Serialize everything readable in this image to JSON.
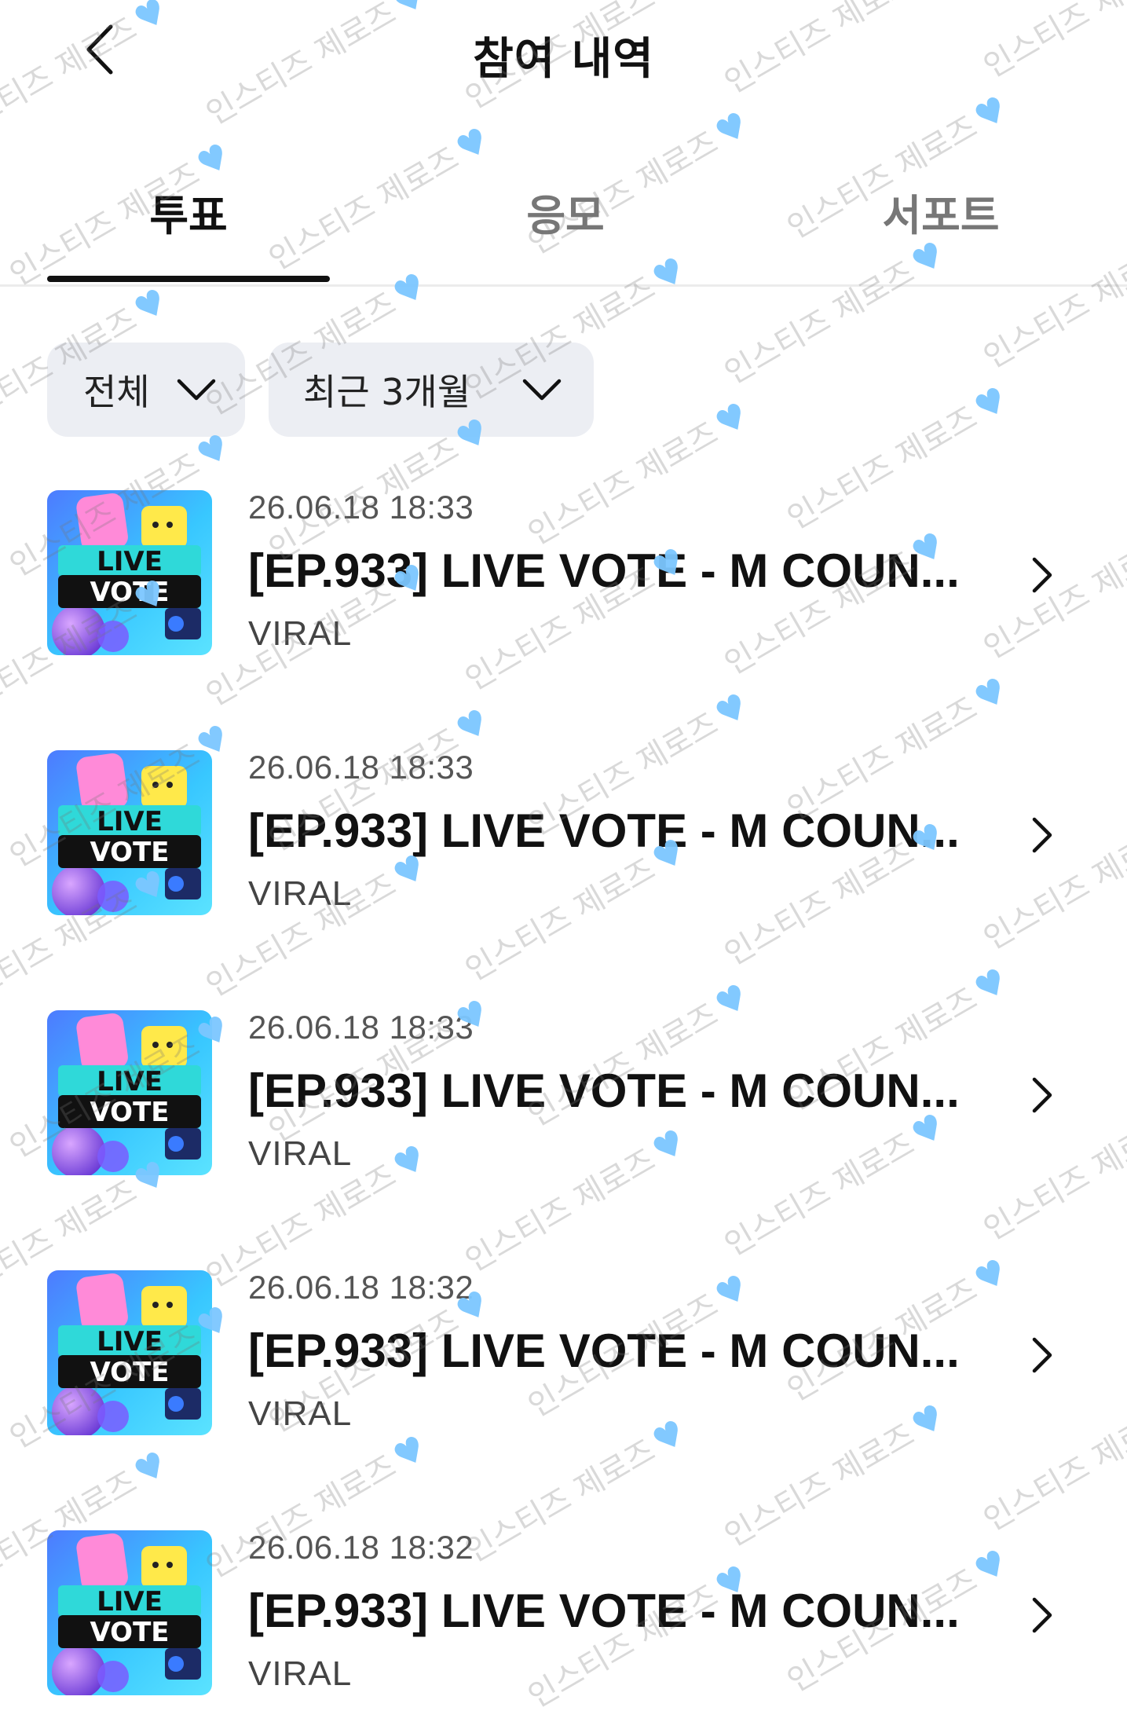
{
  "header": {
    "title": "참여 내역",
    "back_icon": "chevron-left-icon"
  },
  "tabs": [
    {
      "label": "투표",
      "active": true
    },
    {
      "label": "응모",
      "active": false
    },
    {
      "label": "서포트",
      "active": false
    }
  ],
  "filters": {
    "type": {
      "label": "전체",
      "icon": "chevron-down-icon"
    },
    "period": {
      "label": "최근 3개월",
      "icon": "chevron-down-icon"
    }
  },
  "items": [
    {
      "date": "26.06.18 18:33",
      "title": "[EP.933] LIVE VOTE - M COUN...",
      "category": "VIRAL",
      "thumb_text": [
        "LIVE",
        "VOTE"
      ]
    },
    {
      "date": "26.06.18 18:33",
      "title": "[EP.933] LIVE VOTE - M COUN...",
      "category": "VIRAL",
      "thumb_text": [
        "LIVE",
        "VOTE"
      ]
    },
    {
      "date": "26.06.18 18:33",
      "title": "[EP.933] LIVE VOTE - M COUN...",
      "category": "VIRAL",
      "thumb_text": [
        "LIVE",
        "VOTE"
      ]
    },
    {
      "date": "26.06.18 18:32",
      "title": "[EP.933] LIVE VOTE - M COUN...",
      "category": "VIRAL",
      "thumb_text": [
        "LIVE",
        "VOTE"
      ]
    },
    {
      "date": "26.06.18 18:32",
      "title": "[EP.933] LIVE VOTE - M COUN...",
      "category": "VIRAL",
      "thumb_text": [
        "LIVE",
        "VOTE"
      ]
    }
  ],
  "watermark": {
    "text": "인스티즈 제로즈",
    "heart_color": "#7cc7ff"
  },
  "colors": {
    "active_tab": "#111111",
    "inactive_tab": "#777777",
    "chip_bg": "#eceef3",
    "divider": "#ececec"
  }
}
